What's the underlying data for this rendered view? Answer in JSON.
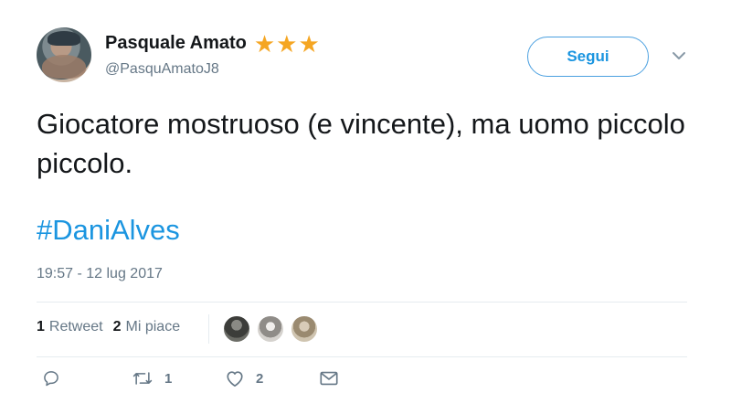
{
  "author": {
    "display_name": "Pasquale Amato",
    "badge": "★★★",
    "handle": "@PasquAmatoJ8"
  },
  "follow_button": {
    "label": "Segui"
  },
  "tweet": {
    "text": "Giocatore mostruoso (e vincente), ma uomo piccolo piccolo.",
    "hashtag": "#DaniAlves",
    "timestamp": "19:57 - 12 lug 2017"
  },
  "stats": {
    "retweets": {
      "count": "1",
      "label": "Retweet"
    },
    "likes": {
      "count": "2",
      "label": "Mi piace"
    }
  },
  "actions": {
    "reply_icon": "reply-icon",
    "retweet_icon": "retweet-icon",
    "retweet_count": "1",
    "like_icon": "heart-icon",
    "like_count": "2",
    "dm_icon": "envelope-icon"
  },
  "colors": {
    "accent": "#1b95e0",
    "stars": "#f5a623",
    "muted_text": "#657786",
    "divider": "#e6ecf0"
  }
}
